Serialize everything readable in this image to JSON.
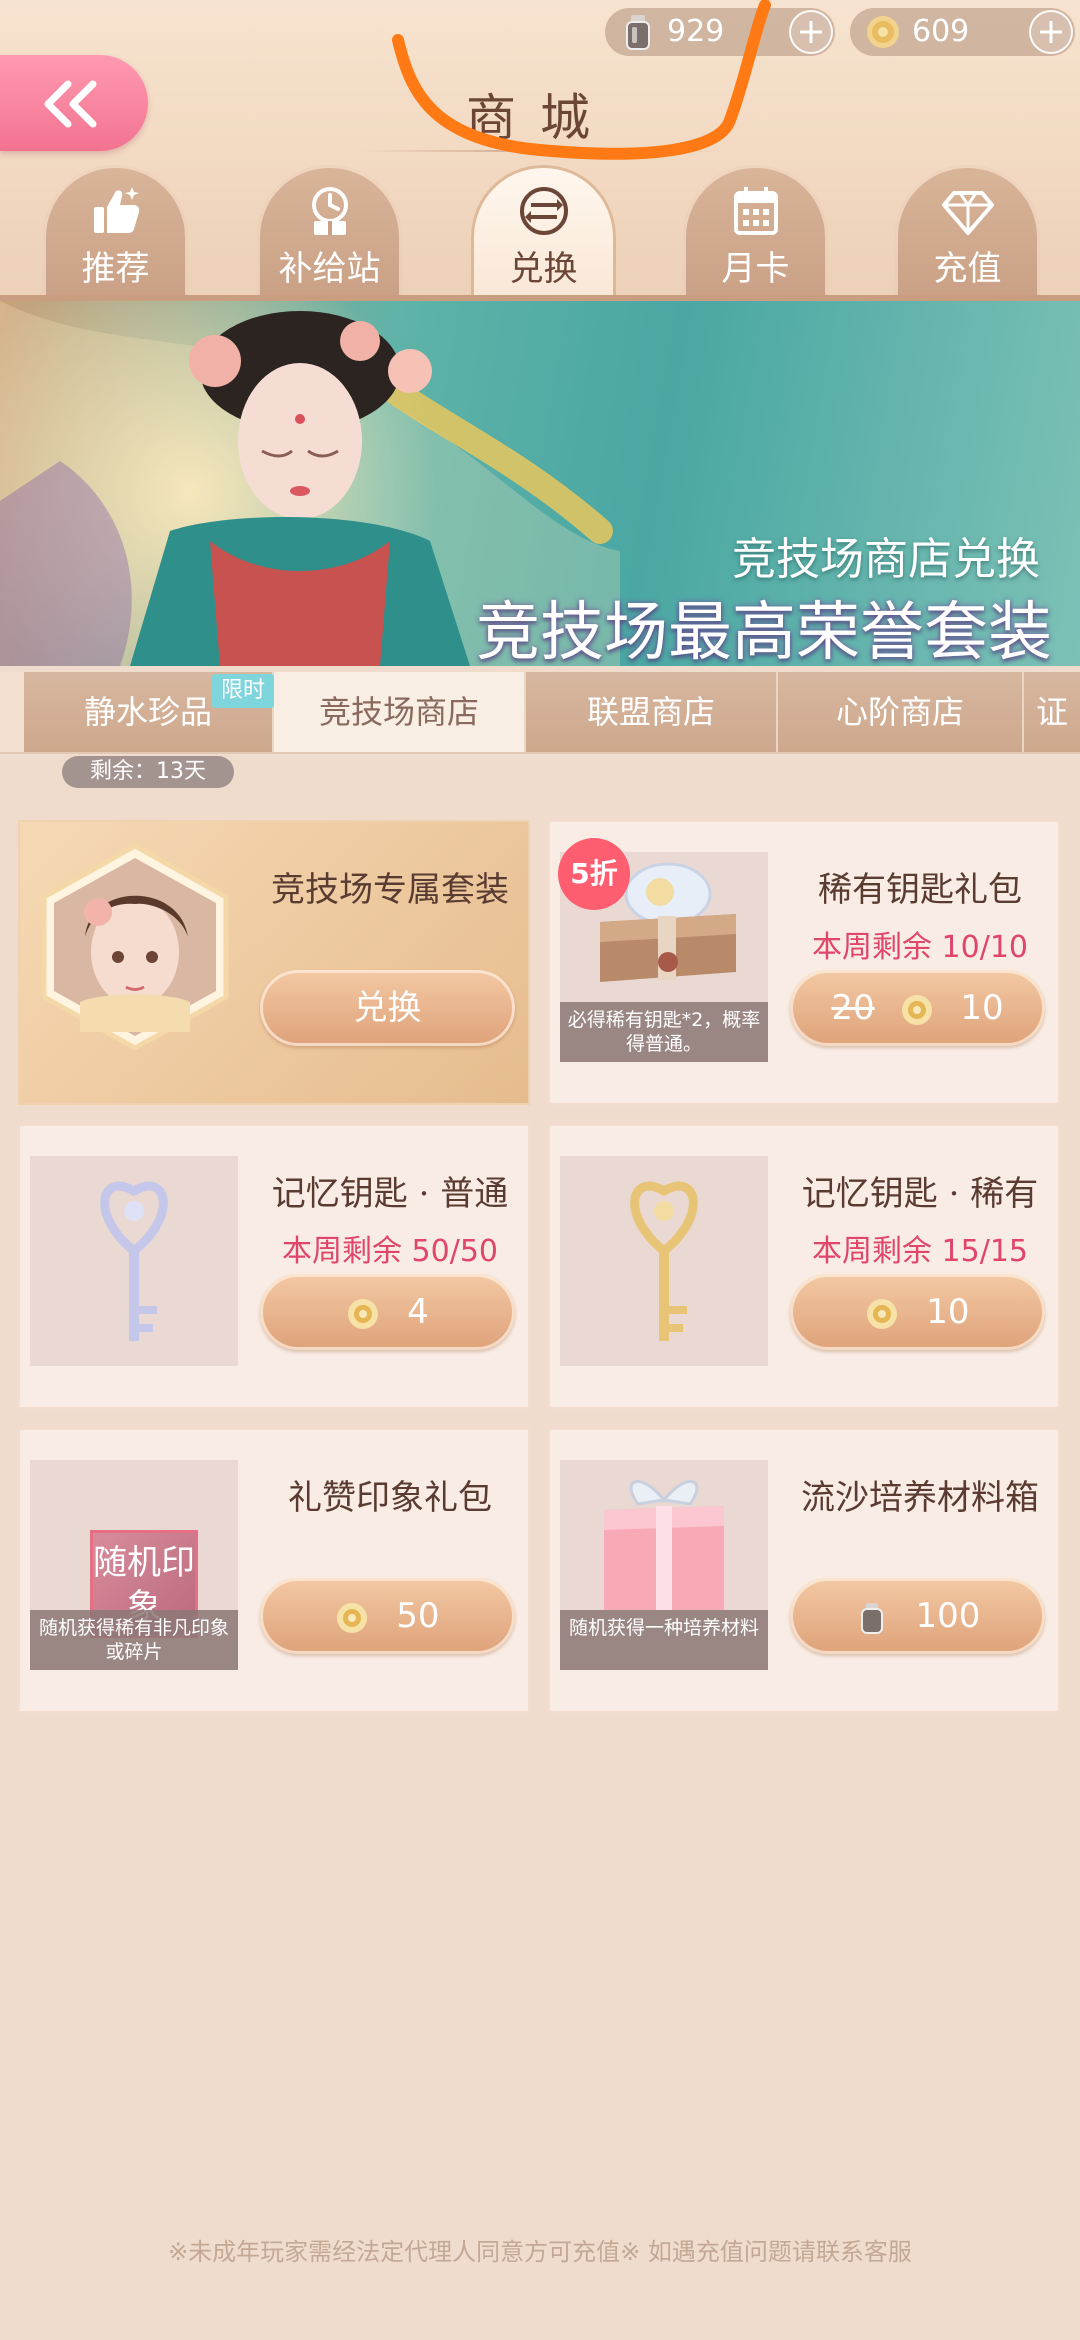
{
  "header": {
    "title": "商城",
    "currency": [
      {
        "icon": "crystal-bottle-icon",
        "value": "929"
      },
      {
        "icon": "gold-rose-icon",
        "value": "609"
      }
    ]
  },
  "tabs": [
    {
      "label": "推荐",
      "icon": "thumbs-up-icon",
      "active": false
    },
    {
      "label": "补给站",
      "icon": "clock-gift-icon",
      "active": false
    },
    {
      "label": "兑换",
      "icon": "exchange-icon",
      "active": true
    },
    {
      "label": "月卡",
      "icon": "calendar-icon",
      "active": false
    },
    {
      "label": "充值",
      "icon": "diamond-icon",
      "active": false
    }
  ],
  "banner": {
    "subtitle": "竞技场商店兑换",
    "title": "竞技场最高荣誉套装"
  },
  "shop_tabs": [
    {
      "label": "静水珍品",
      "active": false
    },
    {
      "label": "竞技场商店",
      "active": true
    },
    {
      "label": "联盟商店",
      "active": false
    },
    {
      "label": "心阶商店",
      "active": false
    },
    {
      "label": "证",
      "active": false
    }
  ],
  "limited_badge": "限时",
  "remaining": "剩余：13天",
  "items": [
    {
      "name": "竞技场专属套装",
      "button": "兑换"
    },
    {
      "name": "稀有钥匙礼包",
      "limit": "本周剩余 10/10",
      "discount": "5折",
      "old_price": "20",
      "price": "10",
      "desc": "必得稀有钥匙*2，概率得普通。"
    },
    {
      "name": "记忆钥匙 · 普通",
      "limit": "本周剩余 50/50",
      "price": "4"
    },
    {
      "name": "记忆钥匙 · 稀有",
      "limit": "本周剩余 15/15",
      "price": "10"
    },
    {
      "name": "礼赞印象礼包",
      "price": "50",
      "tag": "随机印象",
      "desc": "随机获得稀有非凡印象或碎片"
    },
    {
      "name": "流沙培养材料箱",
      "price": "100",
      "desc": "随机获得一种培养材料"
    }
  ],
  "footer": "※未成年玩家需经法定代理人同意方可充值※ 如遇充值问题请联系客服",
  "colors": {
    "accent_pink": "#f27391",
    "limit_red": "#e0456a",
    "button_gold": "#dea27a",
    "badge_cyan": "#7fd5dc"
  }
}
